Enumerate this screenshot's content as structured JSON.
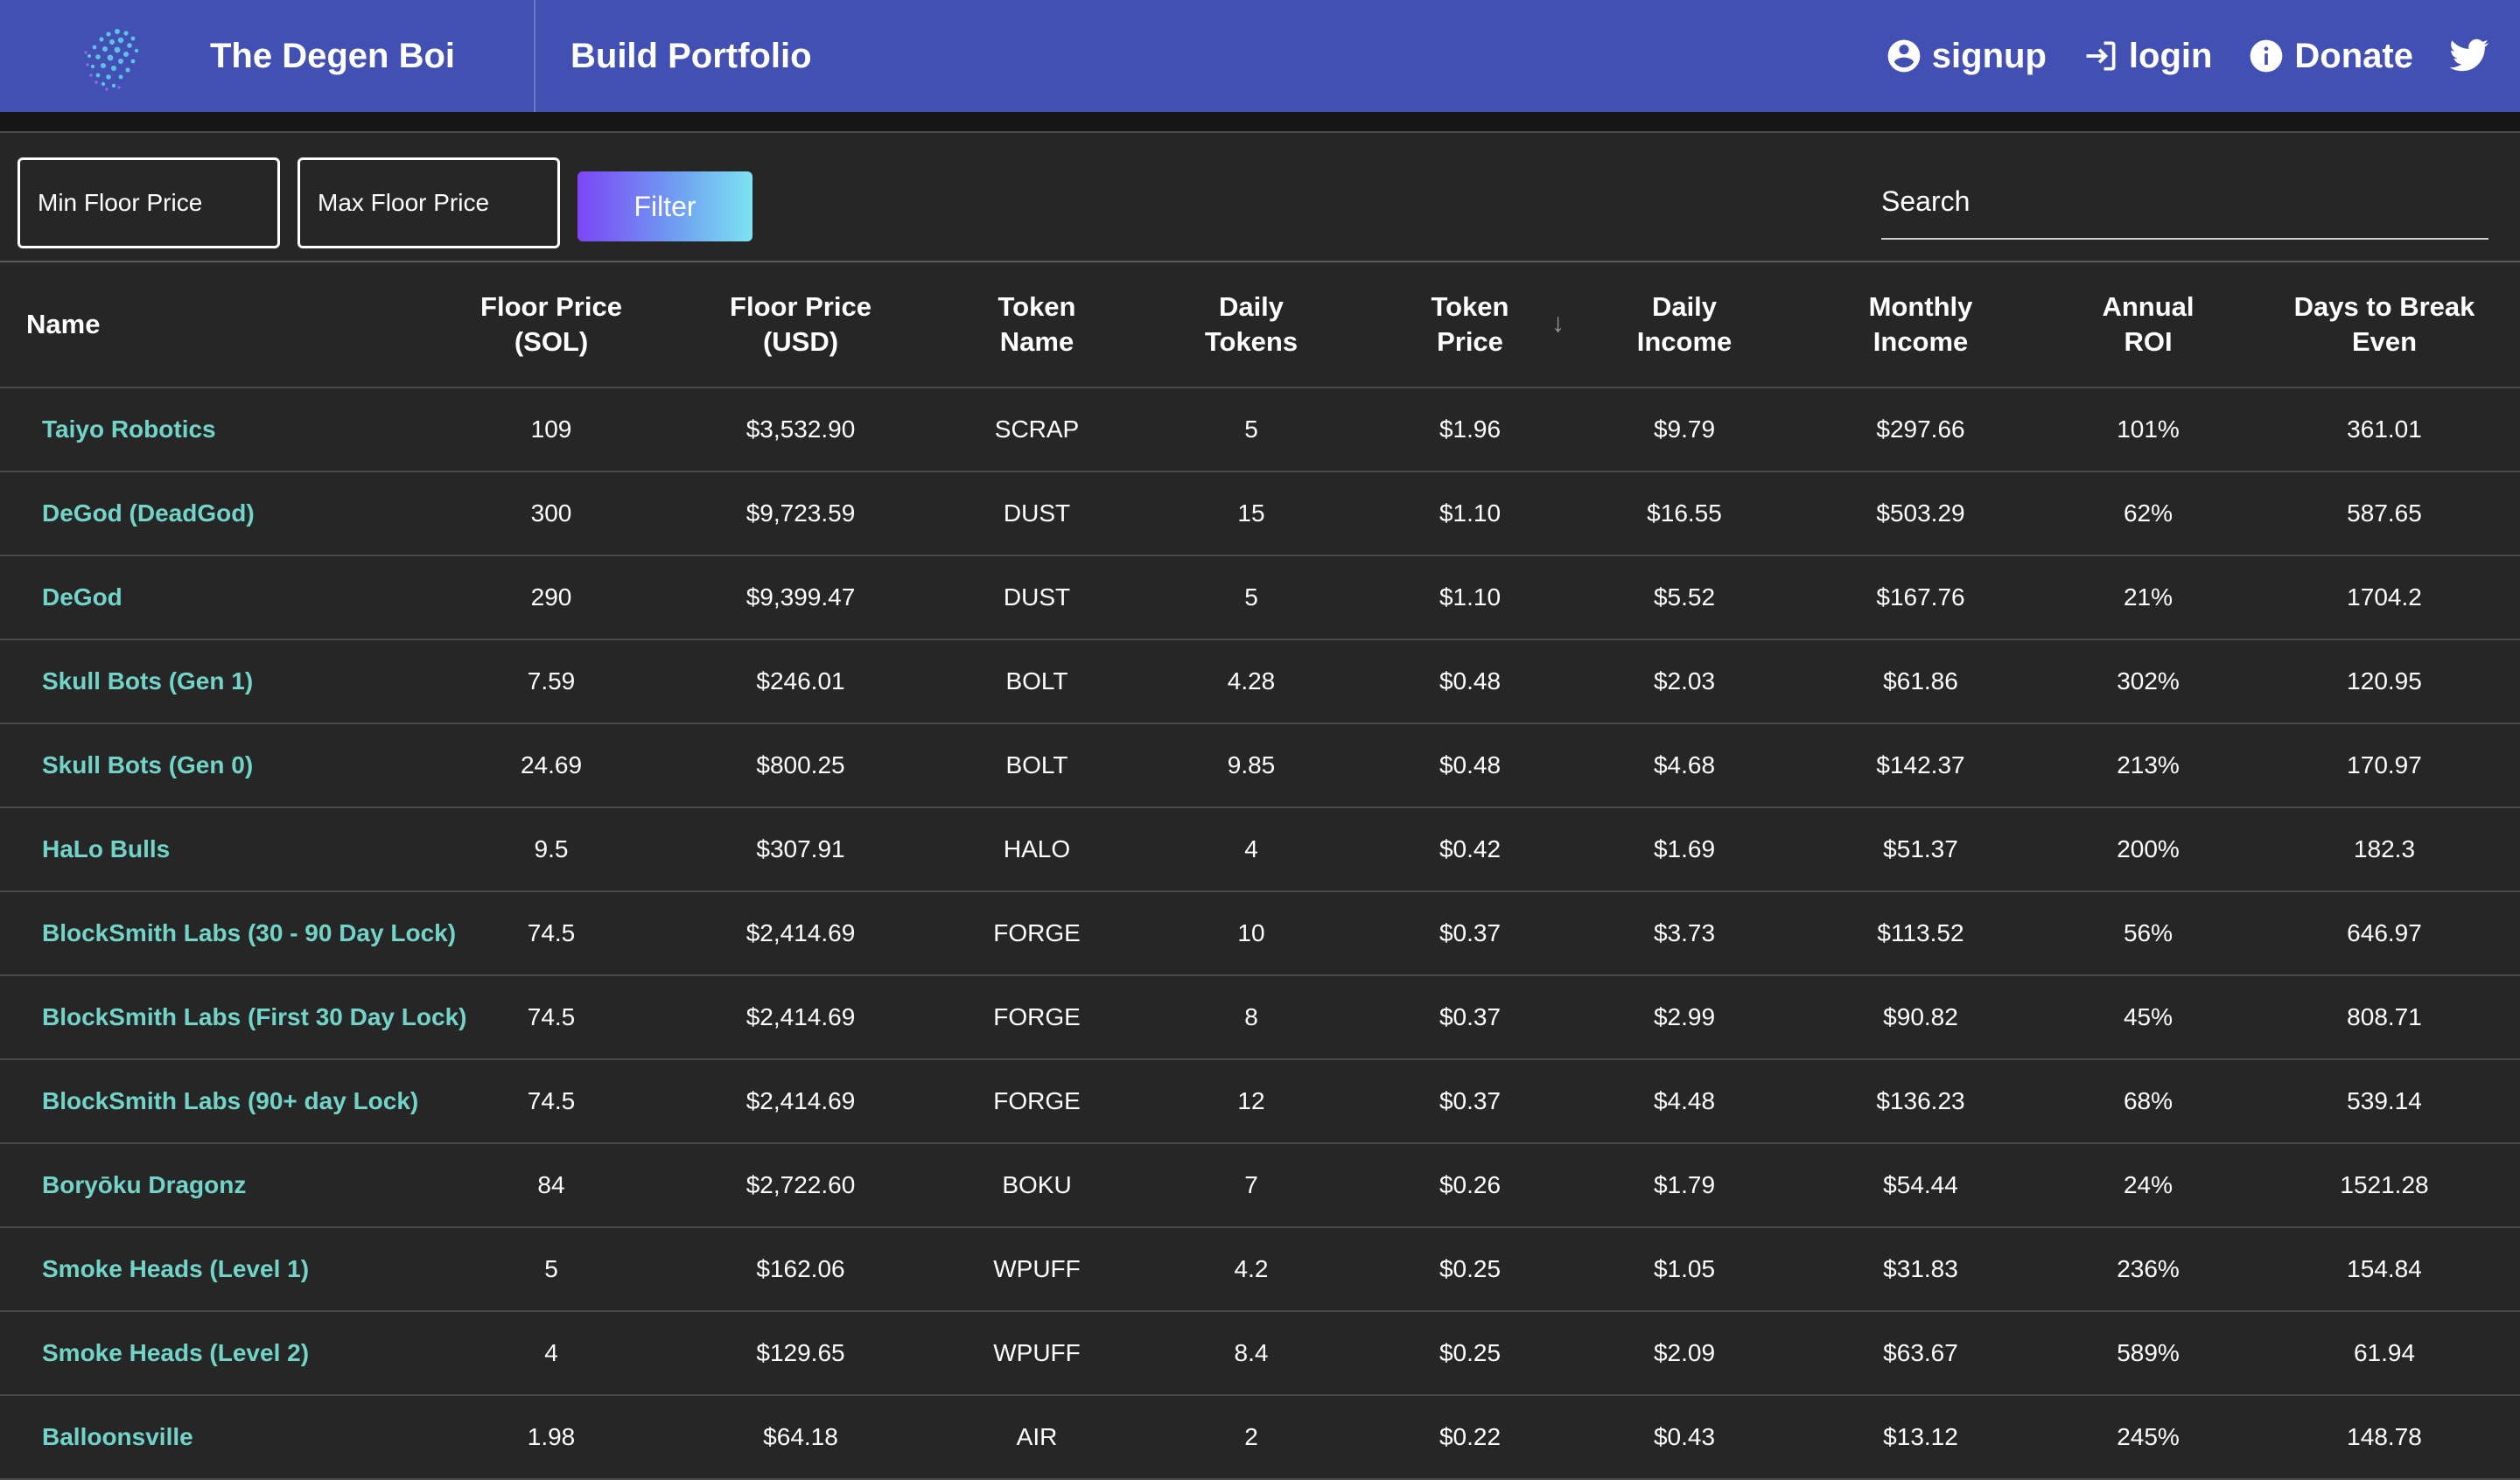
{
  "header": {
    "brand": "The Degen Boi",
    "nav_build": "Build Portfolio",
    "signup": "signup",
    "login": "login",
    "donate": "Donate"
  },
  "icons": {
    "logo": "dotted-globe-logo",
    "signup": "account-circle-icon",
    "login": "login-arrow-icon",
    "donate": "info-icon",
    "twitter": "twitter-bird-icon",
    "sort": "arrow-down-icon"
  },
  "colors": {
    "appbar": "#4350b3",
    "background": "#262626",
    "link": "#72d4c8",
    "filter_gradient_start": "#7b46f5",
    "filter_gradient_end": "#7de3f2"
  },
  "filters": {
    "min_placeholder": "Min Floor Price",
    "max_placeholder": "Max Floor Price",
    "button": "Filter",
    "search_placeholder": "Search"
  },
  "table": {
    "headers": {
      "name": "Name",
      "floor_sol_1": "Floor Price",
      "floor_sol_2": "(SOL)",
      "floor_usd_1": "Floor Price",
      "floor_usd_2": "(USD)",
      "token_name_1": "Token",
      "token_name_2": "Name",
      "daily_tokens_1": "Daily",
      "daily_tokens_2": "Tokens",
      "token_price_1": "Token",
      "token_price_2": "Price",
      "daily_income_1": "Daily",
      "daily_income_2": "Income",
      "monthly_income_1": "Monthly",
      "monthly_income_2": "Income",
      "annual_roi_1": "Annual",
      "annual_roi_2": "ROI",
      "days_1": "Days to Break",
      "days_2": "Even",
      "sort_glyph": "↓"
    },
    "rows": [
      {
        "name": "Taiyo Robotics",
        "floor_sol": "109",
        "floor_usd": "$3,532.90",
        "token": "SCRAP",
        "daily_tokens": "5",
        "token_price": "$1.96",
        "daily_income": "$9.79",
        "monthly_income": "$297.66",
        "annual_roi": "101%",
        "days": "361.01"
      },
      {
        "name": "DeGod (DeadGod)",
        "floor_sol": "300",
        "floor_usd": "$9,723.59",
        "token": "DUST",
        "daily_tokens": "15",
        "token_price": "$1.10",
        "daily_income": "$16.55",
        "monthly_income": "$503.29",
        "annual_roi": "62%",
        "days": "587.65"
      },
      {
        "name": "DeGod",
        "floor_sol": "290",
        "floor_usd": "$9,399.47",
        "token": "DUST",
        "daily_tokens": "5",
        "token_price": "$1.10",
        "daily_income": "$5.52",
        "monthly_income": "$167.76",
        "annual_roi": "21%",
        "days": "1704.2"
      },
      {
        "name": "Skull Bots (Gen 1)",
        "floor_sol": "7.59",
        "floor_usd": "$246.01",
        "token": "BOLT",
        "daily_tokens": "4.28",
        "token_price": "$0.48",
        "daily_income": "$2.03",
        "monthly_income": "$61.86",
        "annual_roi": "302%",
        "days": "120.95"
      },
      {
        "name": "Skull Bots (Gen 0)",
        "floor_sol": "24.69",
        "floor_usd": "$800.25",
        "token": "BOLT",
        "daily_tokens": "9.85",
        "token_price": "$0.48",
        "daily_income": "$4.68",
        "monthly_income": "$142.37",
        "annual_roi": "213%",
        "days": "170.97"
      },
      {
        "name": "HaLo Bulls",
        "floor_sol": "9.5",
        "floor_usd": "$307.91",
        "token": "HALO",
        "daily_tokens": "4",
        "token_price": "$0.42",
        "daily_income": "$1.69",
        "monthly_income": "$51.37",
        "annual_roi": "200%",
        "days": "182.3"
      },
      {
        "name": "BlockSmith Labs (30 - 90 Day Lock)",
        "floor_sol": "74.5",
        "floor_usd": "$2,414.69",
        "token": "FORGE",
        "daily_tokens": "10",
        "token_price": "$0.37",
        "daily_income": "$3.73",
        "monthly_income": "$113.52",
        "annual_roi": "56%",
        "days": "646.97"
      },
      {
        "name": "BlockSmith Labs (First 30 Day Lock)",
        "floor_sol": "74.5",
        "floor_usd": "$2,414.69",
        "token": "FORGE",
        "daily_tokens": "8",
        "token_price": "$0.37",
        "daily_income": "$2.99",
        "monthly_income": "$90.82",
        "annual_roi": "45%",
        "days": "808.71"
      },
      {
        "name": "BlockSmith Labs (90+ day Lock)",
        "floor_sol": "74.5",
        "floor_usd": "$2,414.69",
        "token": "FORGE",
        "daily_tokens": "12",
        "token_price": "$0.37",
        "daily_income": "$4.48",
        "monthly_income": "$136.23",
        "annual_roi": "68%",
        "days": "539.14"
      },
      {
        "name": "Boryōku Dragonz",
        "floor_sol": "84",
        "floor_usd": "$2,722.60",
        "token": "BOKU",
        "daily_tokens": "7",
        "token_price": "$0.26",
        "daily_income": "$1.79",
        "monthly_income": "$54.44",
        "annual_roi": "24%",
        "days": "1521.28"
      },
      {
        "name": "Smoke Heads (Level 1)",
        "floor_sol": "5",
        "floor_usd": "$162.06",
        "token": "WPUFF",
        "daily_tokens": "4.2",
        "token_price": "$0.25",
        "daily_income": "$1.05",
        "monthly_income": "$31.83",
        "annual_roi": "236%",
        "days": "154.84"
      },
      {
        "name": "Smoke Heads (Level 2)",
        "floor_sol": "4",
        "floor_usd": "$129.65",
        "token": "WPUFF",
        "daily_tokens": "8.4",
        "token_price": "$0.25",
        "daily_income": "$2.09",
        "monthly_income": "$63.67",
        "annual_roi": "589%",
        "days": "61.94"
      },
      {
        "name": "Balloonsville",
        "floor_sol": "1.98",
        "floor_usd": "$64.18",
        "token": "AIR",
        "daily_tokens": "2",
        "token_price": "$0.22",
        "daily_income": "$0.43",
        "monthly_income": "$13.12",
        "annual_roi": "245%",
        "days": "148.78"
      }
    ]
  }
}
